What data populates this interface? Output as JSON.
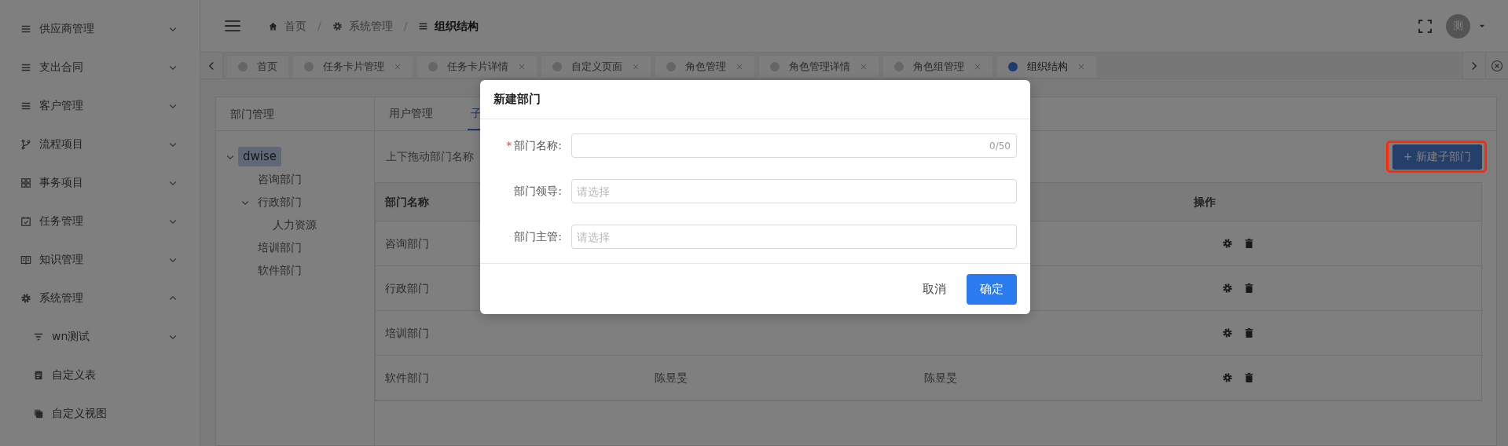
{
  "sidebar": {
    "items": [
      {
        "label": "供应商管理",
        "expanded": false
      },
      {
        "label": "支出合同",
        "expanded": false
      },
      {
        "label": "客户管理",
        "expanded": false
      },
      {
        "label": "流程项目",
        "expanded": false
      },
      {
        "label": "事务项目",
        "expanded": false
      },
      {
        "label": "任务管理",
        "expanded": false
      },
      {
        "label": "知识管理",
        "expanded": false
      },
      {
        "label": "系统管理",
        "expanded": true,
        "children": [
          {
            "label": "wn测试",
            "expanded": false
          },
          {
            "label": "自定义表"
          },
          {
            "label": "自定义视图"
          }
        ]
      }
    ]
  },
  "header": {
    "breadcrumb": [
      {
        "label": "首页",
        "current": false
      },
      {
        "separator": "/",
        "label": "系统管理",
        "current": false
      },
      {
        "separator": "/",
        "label": "组织结构",
        "current": true
      }
    ],
    "avatar": "测"
  },
  "tabs": [
    {
      "label": "首页",
      "selected": false,
      "closable": false
    },
    {
      "label": "任务卡片管理",
      "selected": false,
      "closable": true
    },
    {
      "label": "任务卡片详情",
      "selected": false,
      "closable": true
    },
    {
      "label": "自定义页面",
      "selected": false,
      "closable": true
    },
    {
      "label": "角色管理",
      "selected": false,
      "closable": true
    },
    {
      "label": "角色管理详情",
      "selected": false,
      "closable": true
    },
    {
      "label": "角色组管理",
      "selected": false,
      "closable": true
    },
    {
      "label": "组织结构",
      "selected": true,
      "closable": true
    }
  ],
  "dept_panel": {
    "title": "部门管理",
    "tree": [
      {
        "label": "dwise",
        "selected": true,
        "expanded": true,
        "children": [
          {
            "label": "咨询部门",
            "selected": false
          },
          {
            "label": "行政部门",
            "selected": false,
            "expanded": true,
            "children": [
              {
                "label": "人力资源",
                "selected": false
              }
            ]
          },
          {
            "label": "培训部门",
            "selected": false
          },
          {
            "label": "软件部门",
            "selected": false
          }
        ]
      }
    ]
  },
  "main": {
    "tabs": [
      {
        "label": "用户管理",
        "selected": false
      },
      {
        "label": "子",
        "selected": true
      }
    ],
    "hint": "上下拖动部门名称",
    "add_button": "+ 新建子部门",
    "table": {
      "columns": {
        "column_1": "部门名称",
        "column_4": "操作"
      },
      "rows": [
        {
          "column_1": "咨询部门"
        },
        {
          "column_1": "行政部门"
        },
        {
          "column_1": "培训部门"
        },
        {
          "column_1": "软件部门",
          "column_2": "陈昱旻",
          "column_3": "陈昱旻"
        }
      ]
    }
  },
  "modal": {
    "title": "新建部门",
    "fields": [
      {
        "label": "部门名称:",
        "required_mark": "*",
        "counter": "0/50"
      },
      {
        "label": "部门领导:",
        "placeholder": "请选择"
      },
      {
        "label": "部门主管:",
        "placeholder": "请选择"
      }
    ],
    "buttons": [
      {
        "label": "取消",
        "kind": "text"
      },
      {
        "label": "确定",
        "kind": "primary"
      }
    ]
  }
}
